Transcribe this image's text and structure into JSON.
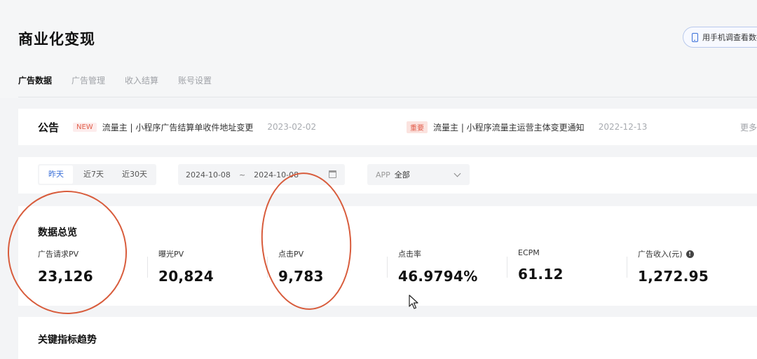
{
  "header": {
    "title": "商业化变现",
    "phone_button": "用手机调查看数据"
  },
  "tabs": [
    {
      "label": "广告数据",
      "active": true
    },
    {
      "label": "广告管理",
      "active": false
    },
    {
      "label": "收入结算",
      "active": false
    },
    {
      "label": "账号设置",
      "active": false
    }
  ],
  "notice": {
    "label": "公告",
    "items": [
      {
        "badge": "NEW",
        "text": "流量主 | 小程序广告结算单收件地址变更",
        "date": "2023-02-02"
      },
      {
        "badge": "重要",
        "text": "流量主 | 小程序流量主运营主体变更通知",
        "date": "2022-12-13"
      }
    ],
    "more": "更多"
  },
  "filter": {
    "ranges": [
      "昨天",
      "近7天",
      "近30天"
    ],
    "active_range": "昨天",
    "date_start": "2024-10-08",
    "date_sep": "~",
    "date_end": "2024-10-08",
    "app_label": "APP",
    "app_value": "全部"
  },
  "overview": {
    "title": "数据总览",
    "metrics": [
      {
        "label": "广告请求PV",
        "value": "23,126"
      },
      {
        "label": "曝光PV",
        "value": "20,824"
      },
      {
        "label": "点击PV",
        "value": "9,783"
      },
      {
        "label": "点击率",
        "value": "46.9794%"
      },
      {
        "label": "ECPM",
        "value": "61.12"
      },
      {
        "label": "广告收入(元)",
        "value": "1,272.95",
        "info": true
      }
    ]
  },
  "trend": {
    "title": "关键指标趋势"
  },
  "colors": {
    "accent": "#3a6fd8",
    "annotation": "#d85c3c",
    "badge_red": "#e25b48"
  }
}
